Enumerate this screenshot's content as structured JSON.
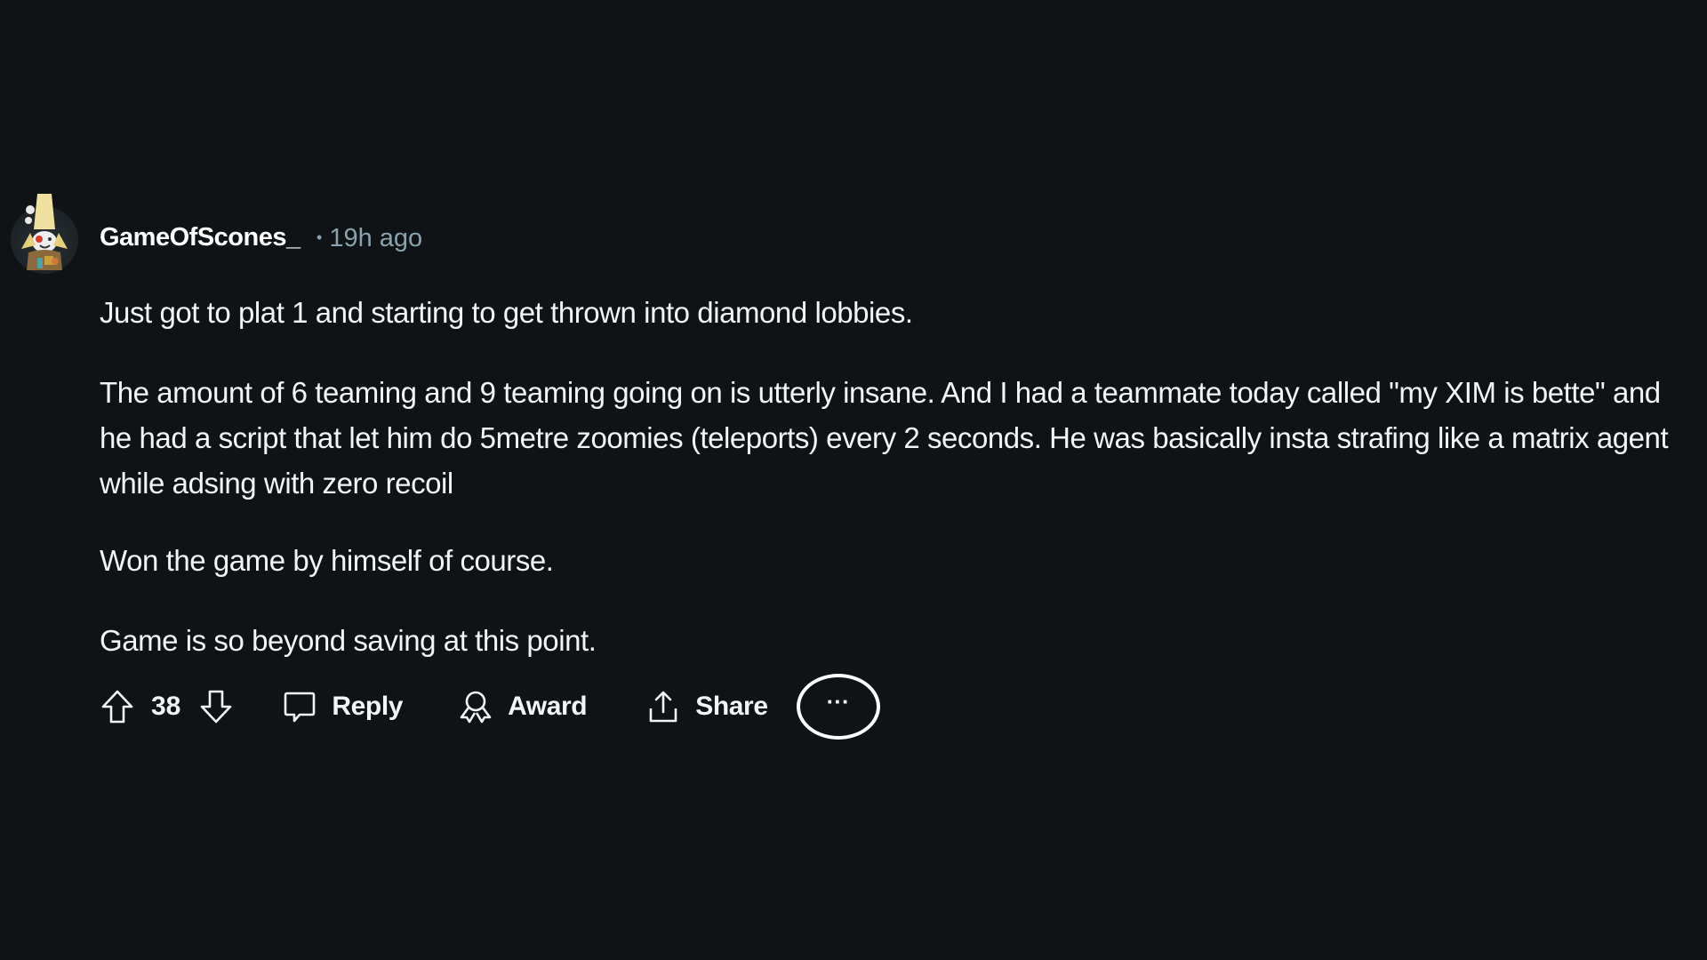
{
  "comment": {
    "author": "GameOfScones_",
    "separator": "•",
    "timestamp": "19h ago",
    "avatar_icon": "snoo-avatar-banana-hat",
    "paragraphs": [
      "Just got to plat 1 and starting to get thrown into diamond lobbies.",
      "The amount of 6 teaming and 9 teaming going on is utterly insane. And I had a teammate today called \"my XIM is bette\" and he had a script that let him do 5metre zoomies (teleports) every 2 seconds. He was basically insta strafing like a matrix agent while adsing with zero recoil",
      "Won the game by himself of course.",
      "Game is so beyond saving at this point."
    ]
  },
  "actions": {
    "upvote_icon": "upvote-arrow-icon",
    "vote_count": "38",
    "downvote_icon": "downvote-arrow-icon",
    "reply_label": "Reply",
    "reply_icon": "comment-bubble-icon",
    "award_label": "Award",
    "award_icon": "award-ribbon-icon",
    "share_label": "Share",
    "share_icon": "share-upload-icon",
    "more_label": "···"
  },
  "colors": {
    "background": "#0f1316",
    "text": "#f2f4f5",
    "meta": "#8ba2ad"
  }
}
